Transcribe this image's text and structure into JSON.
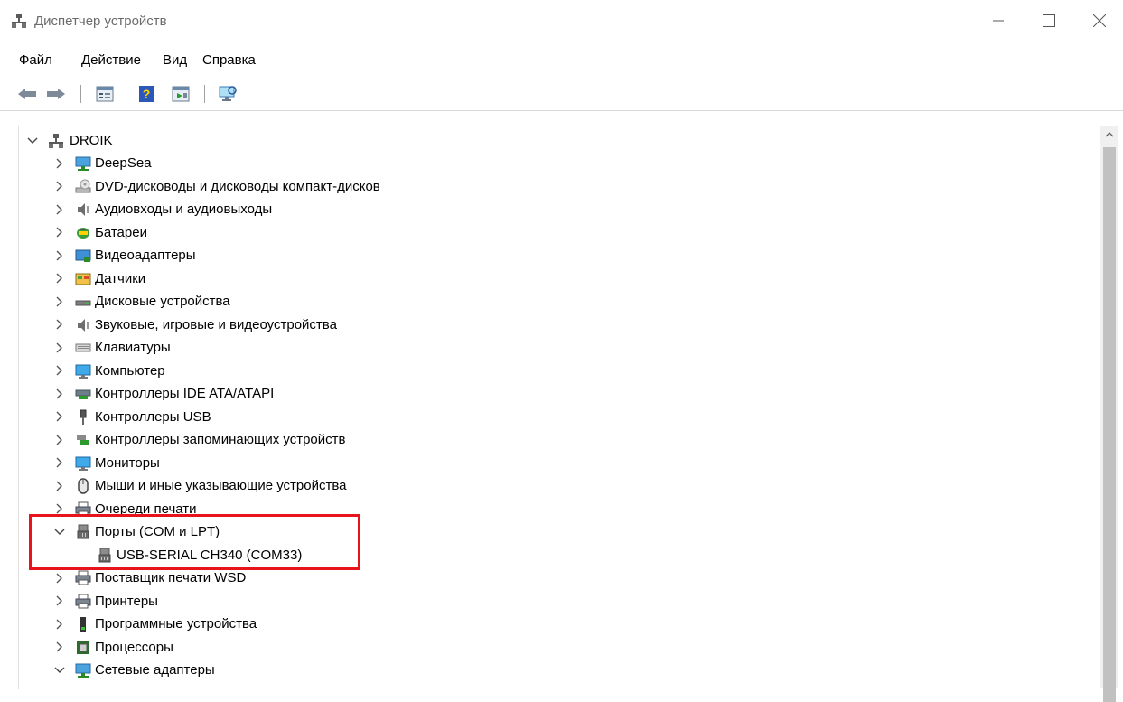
{
  "window": {
    "title": "Диспетчер устройств",
    "controls": {
      "minimize": "minimize-icon",
      "maximize": "maximize-icon",
      "close": "close-icon"
    }
  },
  "menu": [
    "Файл",
    "Действие",
    "Вид",
    "Справка"
  ],
  "toolbar": [
    "back-arrow-icon",
    "forward-arrow-icon",
    "properties-icon",
    "help-icon",
    "update-driver-icon",
    "scan-hardware-icon"
  ],
  "tree": {
    "root": {
      "label": "DROIK",
      "expanded": true,
      "icon": "computer-network-icon"
    },
    "items": [
      {
        "label": "DeepSea",
        "icon": "network-monitor-icon",
        "expanded": false
      },
      {
        "label": "DVD-дисководы и дисководы компакт-дисков",
        "icon": "dvd-drive-icon",
        "expanded": false
      },
      {
        "label": "Аудиовходы и аудиовыходы",
        "icon": "speaker-icon",
        "expanded": false
      },
      {
        "label": "Батареи",
        "icon": "battery-icon",
        "expanded": false
      },
      {
        "label": "Видеоадаптеры",
        "icon": "display-adapter-icon",
        "expanded": false
      },
      {
        "label": "Датчики",
        "icon": "sensor-icon",
        "expanded": false
      },
      {
        "label": "Дисковые устройства",
        "icon": "disk-drive-icon",
        "expanded": false
      },
      {
        "label": "Звуковые, игровые и видеоустройства",
        "icon": "speaker-icon",
        "expanded": false
      },
      {
        "label": "Клавиатуры",
        "icon": "keyboard-icon",
        "expanded": false
      },
      {
        "label": "Компьютер",
        "icon": "monitor-icon",
        "expanded": false
      },
      {
        "label": "Контроллеры IDE ATA/ATAPI",
        "icon": "ide-controller-icon",
        "expanded": false
      },
      {
        "label": "Контроллеры USB",
        "icon": "usb-icon",
        "expanded": false
      },
      {
        "label": "Контроллеры запоминающих устройств",
        "icon": "storage-controller-icon",
        "expanded": false
      },
      {
        "label": "Мониторы",
        "icon": "monitor-icon",
        "expanded": false
      },
      {
        "label": "Мыши и иные указывающие устройства",
        "icon": "mouse-icon",
        "expanded": false
      },
      {
        "label": "Очереди печати",
        "icon": "printer-icon",
        "expanded": false
      },
      {
        "label": "Порты (COM и LPT)",
        "icon": "port-icon",
        "expanded": true
      },
      {
        "label": "USB-SERIAL CH340 (COM33)",
        "icon": "port-icon",
        "child": true
      },
      {
        "label": "Поставщик печати WSD",
        "icon": "printer-icon",
        "expanded": false
      },
      {
        "label": "Принтеры",
        "icon": "printer-icon",
        "expanded": false
      },
      {
        "label": "Программные устройства",
        "icon": "software-device-icon",
        "expanded": false
      },
      {
        "label": "Процессоры",
        "icon": "processor-icon",
        "expanded": false
      },
      {
        "label": "Сетевые адаптеры",
        "icon": "network-monitor-icon",
        "expanded": true
      }
    ]
  },
  "colors": {
    "highlight": "#e8141c",
    "selection": "#cce8ff"
  }
}
